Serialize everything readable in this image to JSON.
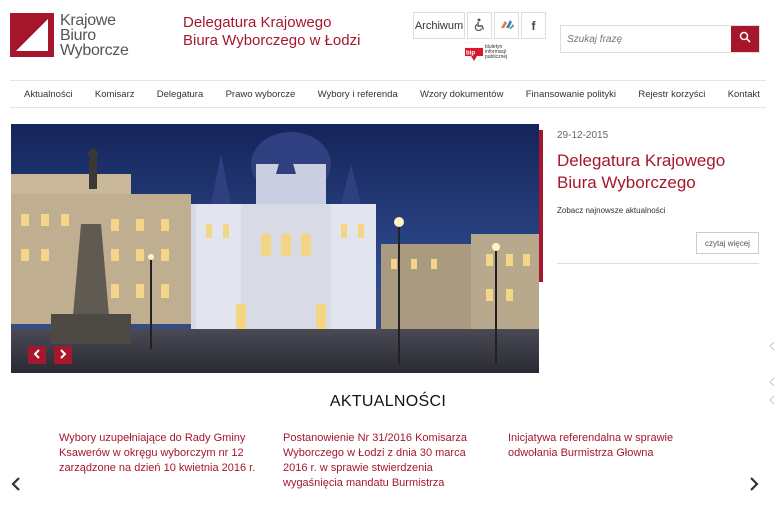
{
  "header": {
    "logo_lines": [
      "Krajowe",
      "Biuro",
      "Wyborcze"
    ],
    "org_title": "Delegatura Krajowego Biura Wyborczego w Łodzi",
    "archive_label": "Archiwum",
    "accessibility_icon": "wheelchair-icon",
    "sign_language_icon": "sign-language-icon",
    "facebook_label": "f",
    "bip_label": "bip",
    "bip_text": "biuletyn informacji publicznej",
    "search_placeholder": "Szukaj frazę"
  },
  "nav": {
    "items": [
      "Aktualności",
      "Komisarz",
      "Delegatura",
      "Prawo wyborcze",
      "Wybory i referenda",
      "Wzory dokumentów",
      "Finansowanie polityki",
      "Rejestr korzyści",
      "Kontakt"
    ]
  },
  "feature": {
    "date": "29-12-2015",
    "title": "Delegatura Krajowego Biura Wyborczego",
    "subtitle": "Zobacz najnowsze aktualności",
    "more_label": "czytaj więcej"
  },
  "news": {
    "heading": "AKTUALNOŚCI",
    "items": [
      "Wybory uzupełniające do Rady Gminy Ksawerów w okręgu wyborczym nr 12 zarządzone na dzień 10 kwietnia 2016 r.",
      "Postanowienie Nr 31/2016 Komisarza Wyborczego w Łodzi z dnia 30 marca 2016 r. w sprawie stwierdzenia wygaśnięcia mandatu Burmistrza",
      "Inicjatywa referendalna w sprawie odwołania Burmistrza Głowna"
    ]
  },
  "colors": {
    "brand": "#a6172d",
    "sky": "#1b2a5c"
  }
}
